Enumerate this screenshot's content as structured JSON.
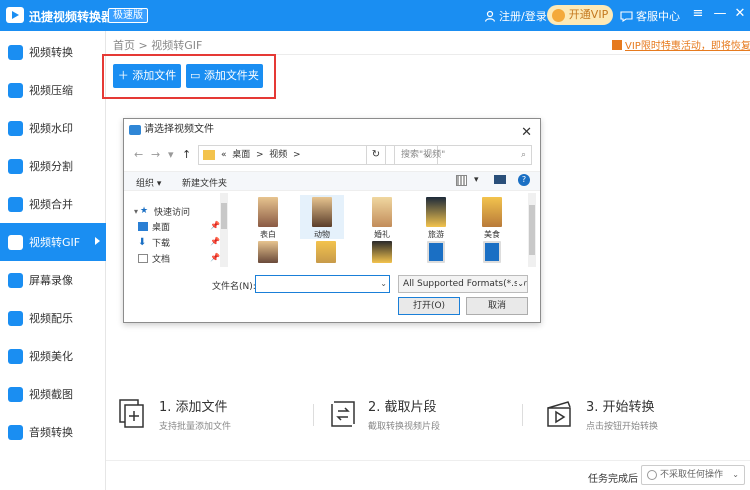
{
  "titlebar": {
    "app_title": "迅捷视频转换器",
    "badge": "极速版",
    "user": "注册/登录",
    "vip": "开通VIP",
    "service": "客服中心",
    "minimize": "—",
    "maximize": "□",
    "close": "✕"
  },
  "sidebar": {
    "items": [
      {
        "label": "视频转换"
      },
      {
        "label": "视频压缩"
      },
      {
        "label": "视频水印"
      },
      {
        "label": "视频分割"
      },
      {
        "label": "视频合并"
      },
      {
        "label": "视频转GIF"
      },
      {
        "label": "屏幕录像"
      },
      {
        "label": "视频配乐"
      },
      {
        "label": "视频美化"
      },
      {
        "label": "视频截图"
      },
      {
        "label": "音频转换"
      }
    ],
    "active_index": 5
  },
  "breadcrumb": {
    "home": "首页",
    "sep": ">",
    "current": "视频转GIF"
  },
  "promo": "VIP限时特惠活动，即将恢复原价",
  "buttons": {
    "add_file": "添加文件",
    "add_folder": "添加文件夹"
  },
  "dialog": {
    "title": "请选择视频文件",
    "close": "✕",
    "address": [
      "«",
      "桌面",
      ">",
      "视频",
      ">"
    ],
    "search_placeholder": "搜索\"视频\"",
    "organize": "组织 ▾",
    "new_folder": "新建文件夹",
    "tree": [
      {
        "label": "快速访问",
        "icon": "star-icon"
      },
      {
        "label": "桌面",
        "icon": "desktop-icon"
      },
      {
        "label": "下载",
        "icon": "download-icon"
      },
      {
        "label": "文档",
        "icon": "document-icon"
      }
    ],
    "files_row1": [
      "表白",
      "动物",
      "婚礼",
      "旅游",
      "美食"
    ],
    "filename_label": "文件名(N):",
    "filename_value": "",
    "filter": "All Supported Formats(*.swf;",
    "open": "打开(O)",
    "cancel": "取消"
  },
  "steps": [
    {
      "title": "1. 添加文件",
      "desc": "支持批量添加文件"
    },
    {
      "title": "2. 截取片段",
      "desc": "截取转换视频片段"
    },
    {
      "title": "3. 开始转换",
      "desc": "点击按钮开始转换"
    }
  ],
  "footer": {
    "label": "任务完成后",
    "select": "不采取任何操作"
  },
  "colors": {
    "accent": "#1a8ef2",
    "highlight": "#e53935",
    "promo": "#e67a1e"
  }
}
